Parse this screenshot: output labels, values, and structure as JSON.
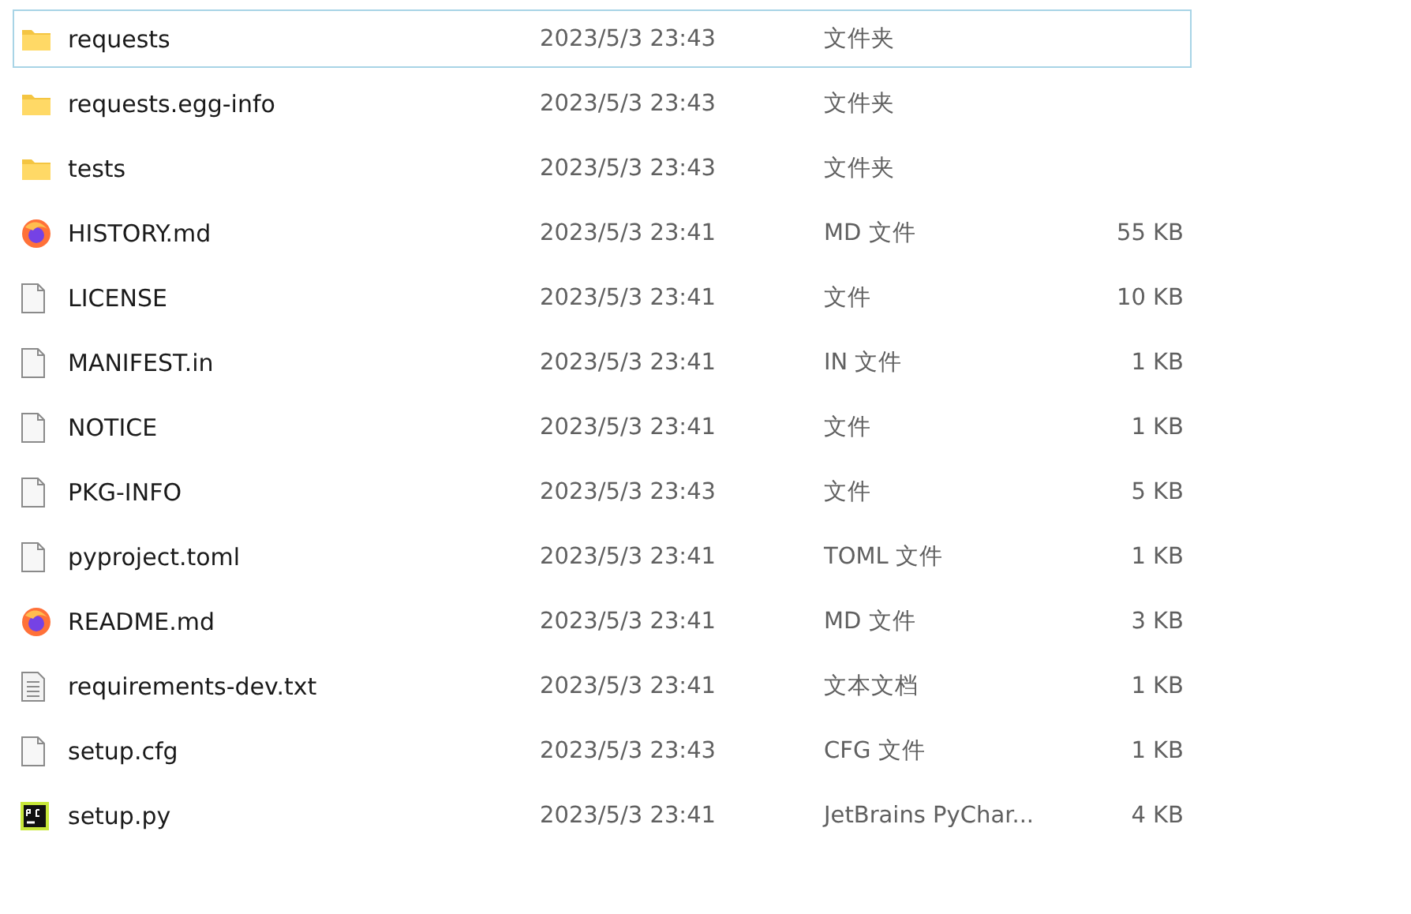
{
  "files": [
    {
      "kind": "folder",
      "name": "requests",
      "date": "2023/5/3 23:43",
      "type": "文件夹",
      "selected": true
    },
    {
      "kind": "folder",
      "name": "requests.egg-info",
      "date": "2023/5/3 23:43",
      "type": "文件夹",
      "selected": false
    },
    {
      "kind": "folder",
      "name": "tests",
      "date": "2023/5/3 23:43",
      "type": "文件夹",
      "selected": false
    },
    {
      "kind": "browser",
      "name": "HISTORY.md",
      "date": "2023/5/3 23:41",
      "type": "MD 文件",
      "size": "55 KB",
      "selected": false
    },
    {
      "kind": "file",
      "name": "LICENSE",
      "date": "2023/5/3 23:41",
      "type": "文件",
      "size": "10 KB",
      "selected": false
    },
    {
      "kind": "file",
      "name": "MANIFEST.in",
      "date": "2023/5/3 23:41",
      "type": "IN 文件",
      "size": "1 KB",
      "selected": false
    },
    {
      "kind": "file",
      "name": "NOTICE",
      "date": "2023/5/3 23:41",
      "type": "文件",
      "size": "1 KB",
      "selected": false
    },
    {
      "kind": "file",
      "name": "PKG-INFO",
      "date": "2023/5/3 23:43",
      "type": "文件",
      "size": "5 KB",
      "selected": false
    },
    {
      "kind": "file",
      "name": "pyproject.toml",
      "date": "2023/5/3 23:41",
      "type": "TOML 文件",
      "size": "1 KB",
      "selected": false
    },
    {
      "kind": "browser",
      "name": "README.md",
      "date": "2023/5/3 23:41",
      "type": "MD 文件",
      "size": "3 KB",
      "selected": false
    },
    {
      "kind": "text",
      "name": "requirements-dev.txt",
      "date": "2023/5/3 23:41",
      "type": "文本文档",
      "size": "1 KB",
      "selected": false
    },
    {
      "kind": "file",
      "name": "setup.cfg",
      "date": "2023/5/3 23:43",
      "type": "CFG 文件",
      "size": "1 KB",
      "selected": false
    },
    {
      "kind": "ide",
      "name": "setup.py",
      "date": "2023/5/3 23:41",
      "type": "JetBrains PyChar...",
      "size": "4 KB",
      "selected": false
    }
  ]
}
